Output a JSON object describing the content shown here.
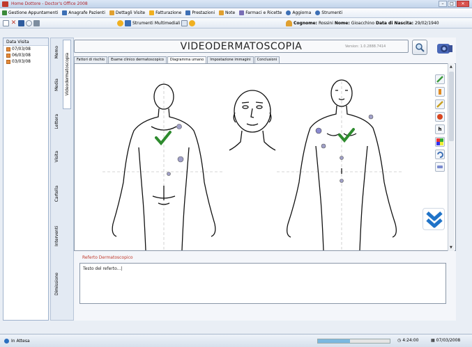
{
  "window": {
    "title": "Home Dottore - Doctor's Office 2008"
  },
  "menu": [
    {
      "label": "Gestione Appuntamenti"
    },
    {
      "label": "Anagrafe Pazienti"
    },
    {
      "label": "Dettagli Visite"
    },
    {
      "label": "Fatturazione"
    },
    {
      "label": "Prestazioni"
    },
    {
      "label": "Note"
    },
    {
      "label": "Farmaci e Ricette"
    },
    {
      "label": "Aggiorna"
    },
    {
      "label": "Strumenti"
    }
  ],
  "toolbar": {
    "multimedia_label": "Strumenti Multimediali",
    "patient": {
      "cognome_label": "Cognome:",
      "cognome": "Rossini",
      "nome_label": "Nome:",
      "nome": "Gioacchino",
      "nascita_label": "Data di Nascita:",
      "nascita": "29/02/1940"
    }
  },
  "visits": {
    "header": "Data Visita",
    "dates": [
      "07/03/08",
      "06/03/08",
      "03/03/08"
    ]
  },
  "vtabs": [
    "Memo",
    "Media",
    "Lettera",
    "Visita",
    "Cartella",
    "Interventi",
    "Dimissione",
    "Videodermatoscopia"
  ],
  "main": {
    "title": "VIDEODERMATOSCOPIA",
    "version": "Version: 1.0.2888.7414",
    "tabs": [
      {
        "label": "Fattori di rischio"
      },
      {
        "label": "Esame clinico dermatoscopico"
      },
      {
        "label": "Diagramma umano",
        "active": true
      },
      {
        "label": "Impostazione immagini"
      },
      {
        "label": "Conclusioni"
      }
    ],
    "referto_label": "Referto Dermatoscopico",
    "referto_text": "Testo del referto...|"
  },
  "statusbar": {
    "state": "In Attesa",
    "progress": 0.45,
    "time": "4:24:00",
    "date": "07/03/2008"
  },
  "colors": {
    "check": "#2e8b2e",
    "chevron": "#1f73c8",
    "title_accent": "#b0232a"
  }
}
